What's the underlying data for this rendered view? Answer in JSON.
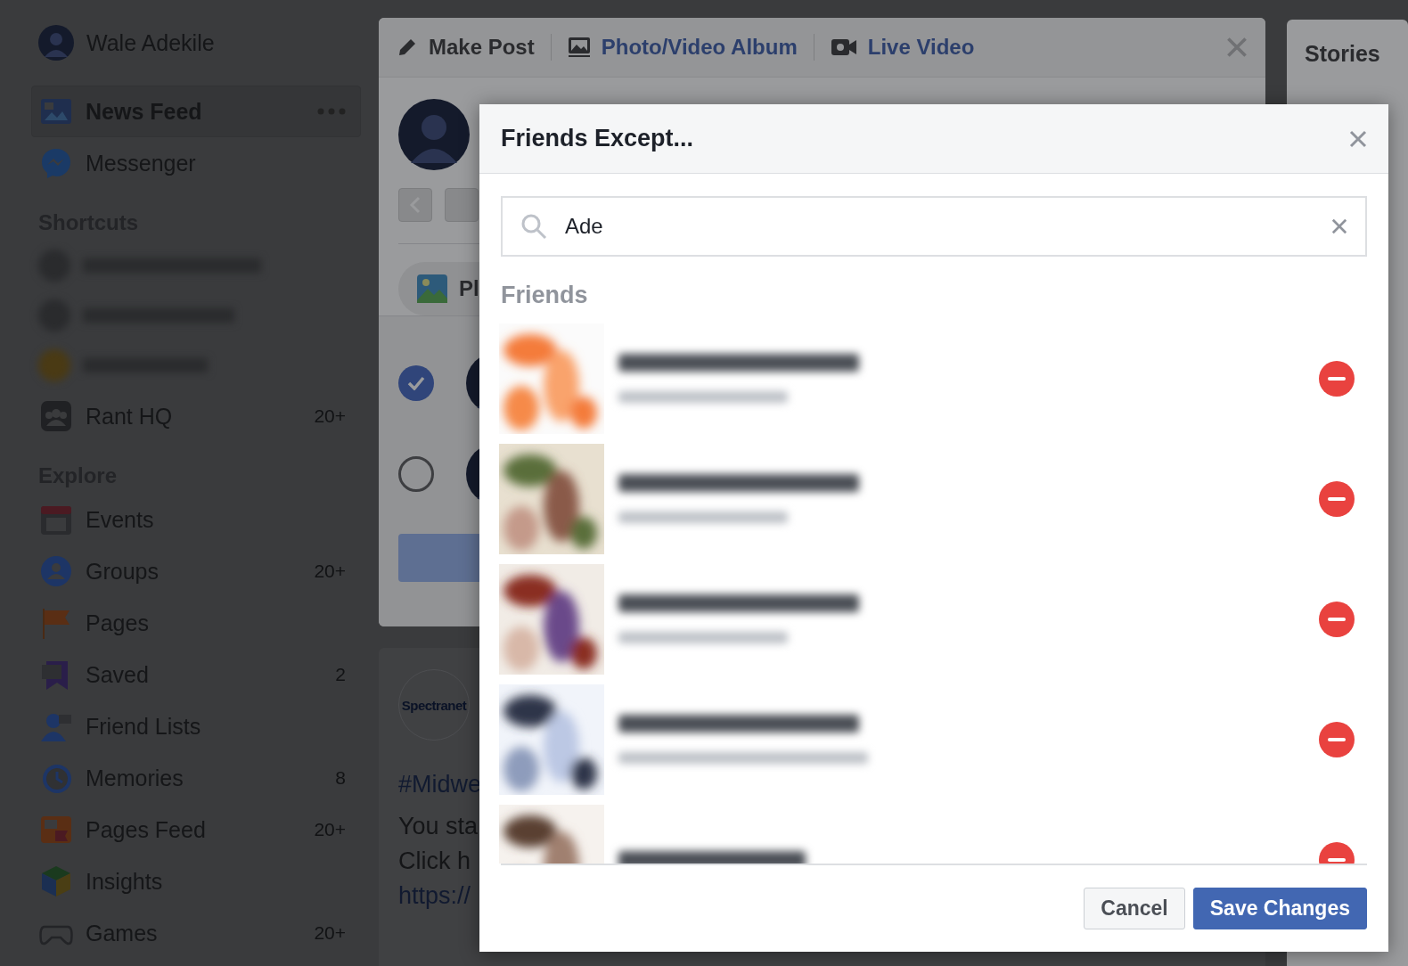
{
  "sidebar": {
    "profile_name": "Wale Adekile",
    "top_items": [
      {
        "label": "News Feed",
        "selected": true
      },
      {
        "label": "Messenger",
        "selected": false
      }
    ],
    "sections": [
      {
        "title": "Shortcuts",
        "items": [
          {
            "kind": "blurred"
          },
          {
            "kind": "blurred"
          },
          {
            "kind": "blurred"
          },
          {
            "kind": "link",
            "label": "Rant HQ",
            "count": "20+"
          }
        ]
      },
      {
        "title": "Explore",
        "items": [
          {
            "kind": "link",
            "label": "Events"
          },
          {
            "kind": "link",
            "label": "Groups",
            "count": "20+"
          },
          {
            "kind": "link",
            "label": "Pages"
          },
          {
            "kind": "link",
            "label": "Saved",
            "count": "2"
          },
          {
            "kind": "link",
            "label": "Friend Lists"
          },
          {
            "kind": "link",
            "label": "Memories",
            "count": "8"
          },
          {
            "kind": "link",
            "label": "Pages Feed",
            "count": "20+"
          },
          {
            "kind": "link",
            "label": "Insights"
          },
          {
            "kind": "link",
            "label": "Games",
            "count": "20+"
          }
        ]
      }
    ]
  },
  "composer": {
    "tabs": [
      {
        "label": "Make Post",
        "selected": true
      },
      {
        "label": "Photo/Video Album",
        "selected": false
      },
      {
        "label": "Live Video",
        "selected": false
      }
    ],
    "chip": "Pl",
    "audience_options": [
      {
        "selected": true
      },
      {
        "selected": false
      }
    ]
  },
  "post": {
    "logo": "Spectranet",
    "hashtag": "#Midwe",
    "lines": [
      "You sta",
      "Click h"
    ],
    "link": "https://"
  },
  "stories": {
    "title": "Stories"
  },
  "dialog": {
    "title": "Friends Except...",
    "search": {
      "value": "Ade"
    },
    "section_title": "Friends",
    "friends": [
      {
        "excluded": true
      },
      {
        "excluded": true
      },
      {
        "excluded": true
      },
      {
        "excluded": true
      },
      {
        "excluded": true
      }
    ],
    "buttons": {
      "cancel": "Cancel",
      "save": "Save Changes"
    }
  }
}
